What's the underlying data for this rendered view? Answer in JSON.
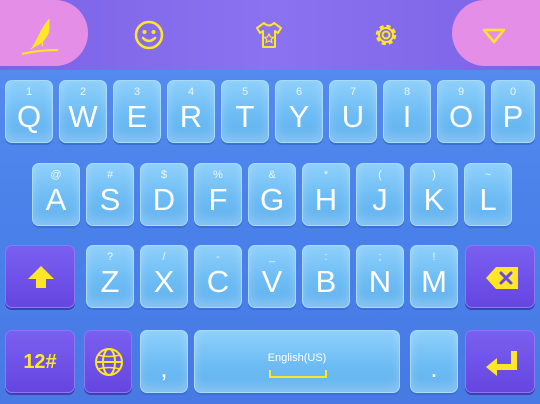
{
  "toolbar": {
    "logo_icon": "bird-logo-icon",
    "emoji_icon": "smiley-icon",
    "theme_icon": "tshirt-icon",
    "settings_icon": "gear-icon",
    "hide_icon": "triangle-down-icon"
  },
  "rows": [
    {
      "keys": [
        {
          "main": "Q",
          "sub": "1"
        },
        {
          "main": "W",
          "sub": "2"
        },
        {
          "main": "E",
          "sub": "3"
        },
        {
          "main": "R",
          "sub": "4"
        },
        {
          "main": "T",
          "sub": "5"
        },
        {
          "main": "Y",
          "sub": "6"
        },
        {
          "main": "U",
          "sub": "7"
        },
        {
          "main": "I",
          "sub": "8"
        },
        {
          "main": "O",
          "sub": "9"
        },
        {
          "main": "P",
          "sub": "0"
        }
      ]
    },
    {
      "keys": [
        {
          "main": "A",
          "sub": "@"
        },
        {
          "main": "S",
          "sub": "#"
        },
        {
          "main": "D",
          "sub": "$"
        },
        {
          "main": "F",
          "sub": "%"
        },
        {
          "main": "G",
          "sub": "&"
        },
        {
          "main": "H",
          "sub": "*"
        },
        {
          "main": "J",
          "sub": "("
        },
        {
          "main": "K",
          "sub": ")"
        },
        {
          "main": "L",
          "sub": "~"
        }
      ]
    },
    {
      "keys": [
        {
          "main": "Z",
          "sub": "?"
        },
        {
          "main": "X",
          "sub": "/"
        },
        {
          "main": "C",
          "sub": "-"
        },
        {
          "main": "V",
          "sub": "_"
        },
        {
          "main": "B",
          "sub": ":"
        },
        {
          "main": "N",
          "sub": ";"
        },
        {
          "main": "M",
          "sub": "!"
        }
      ]
    }
  ],
  "bottom": {
    "numbers_label": "12#",
    "comma_label": ",",
    "period_label": ".",
    "space_label": "English(US)"
  },
  "colors": {
    "accent": "#ffe629",
    "key": "#6dbcf4",
    "function_key": "#6a4be3",
    "topbar": "#7f68ea",
    "pill": "#e58ee8"
  }
}
